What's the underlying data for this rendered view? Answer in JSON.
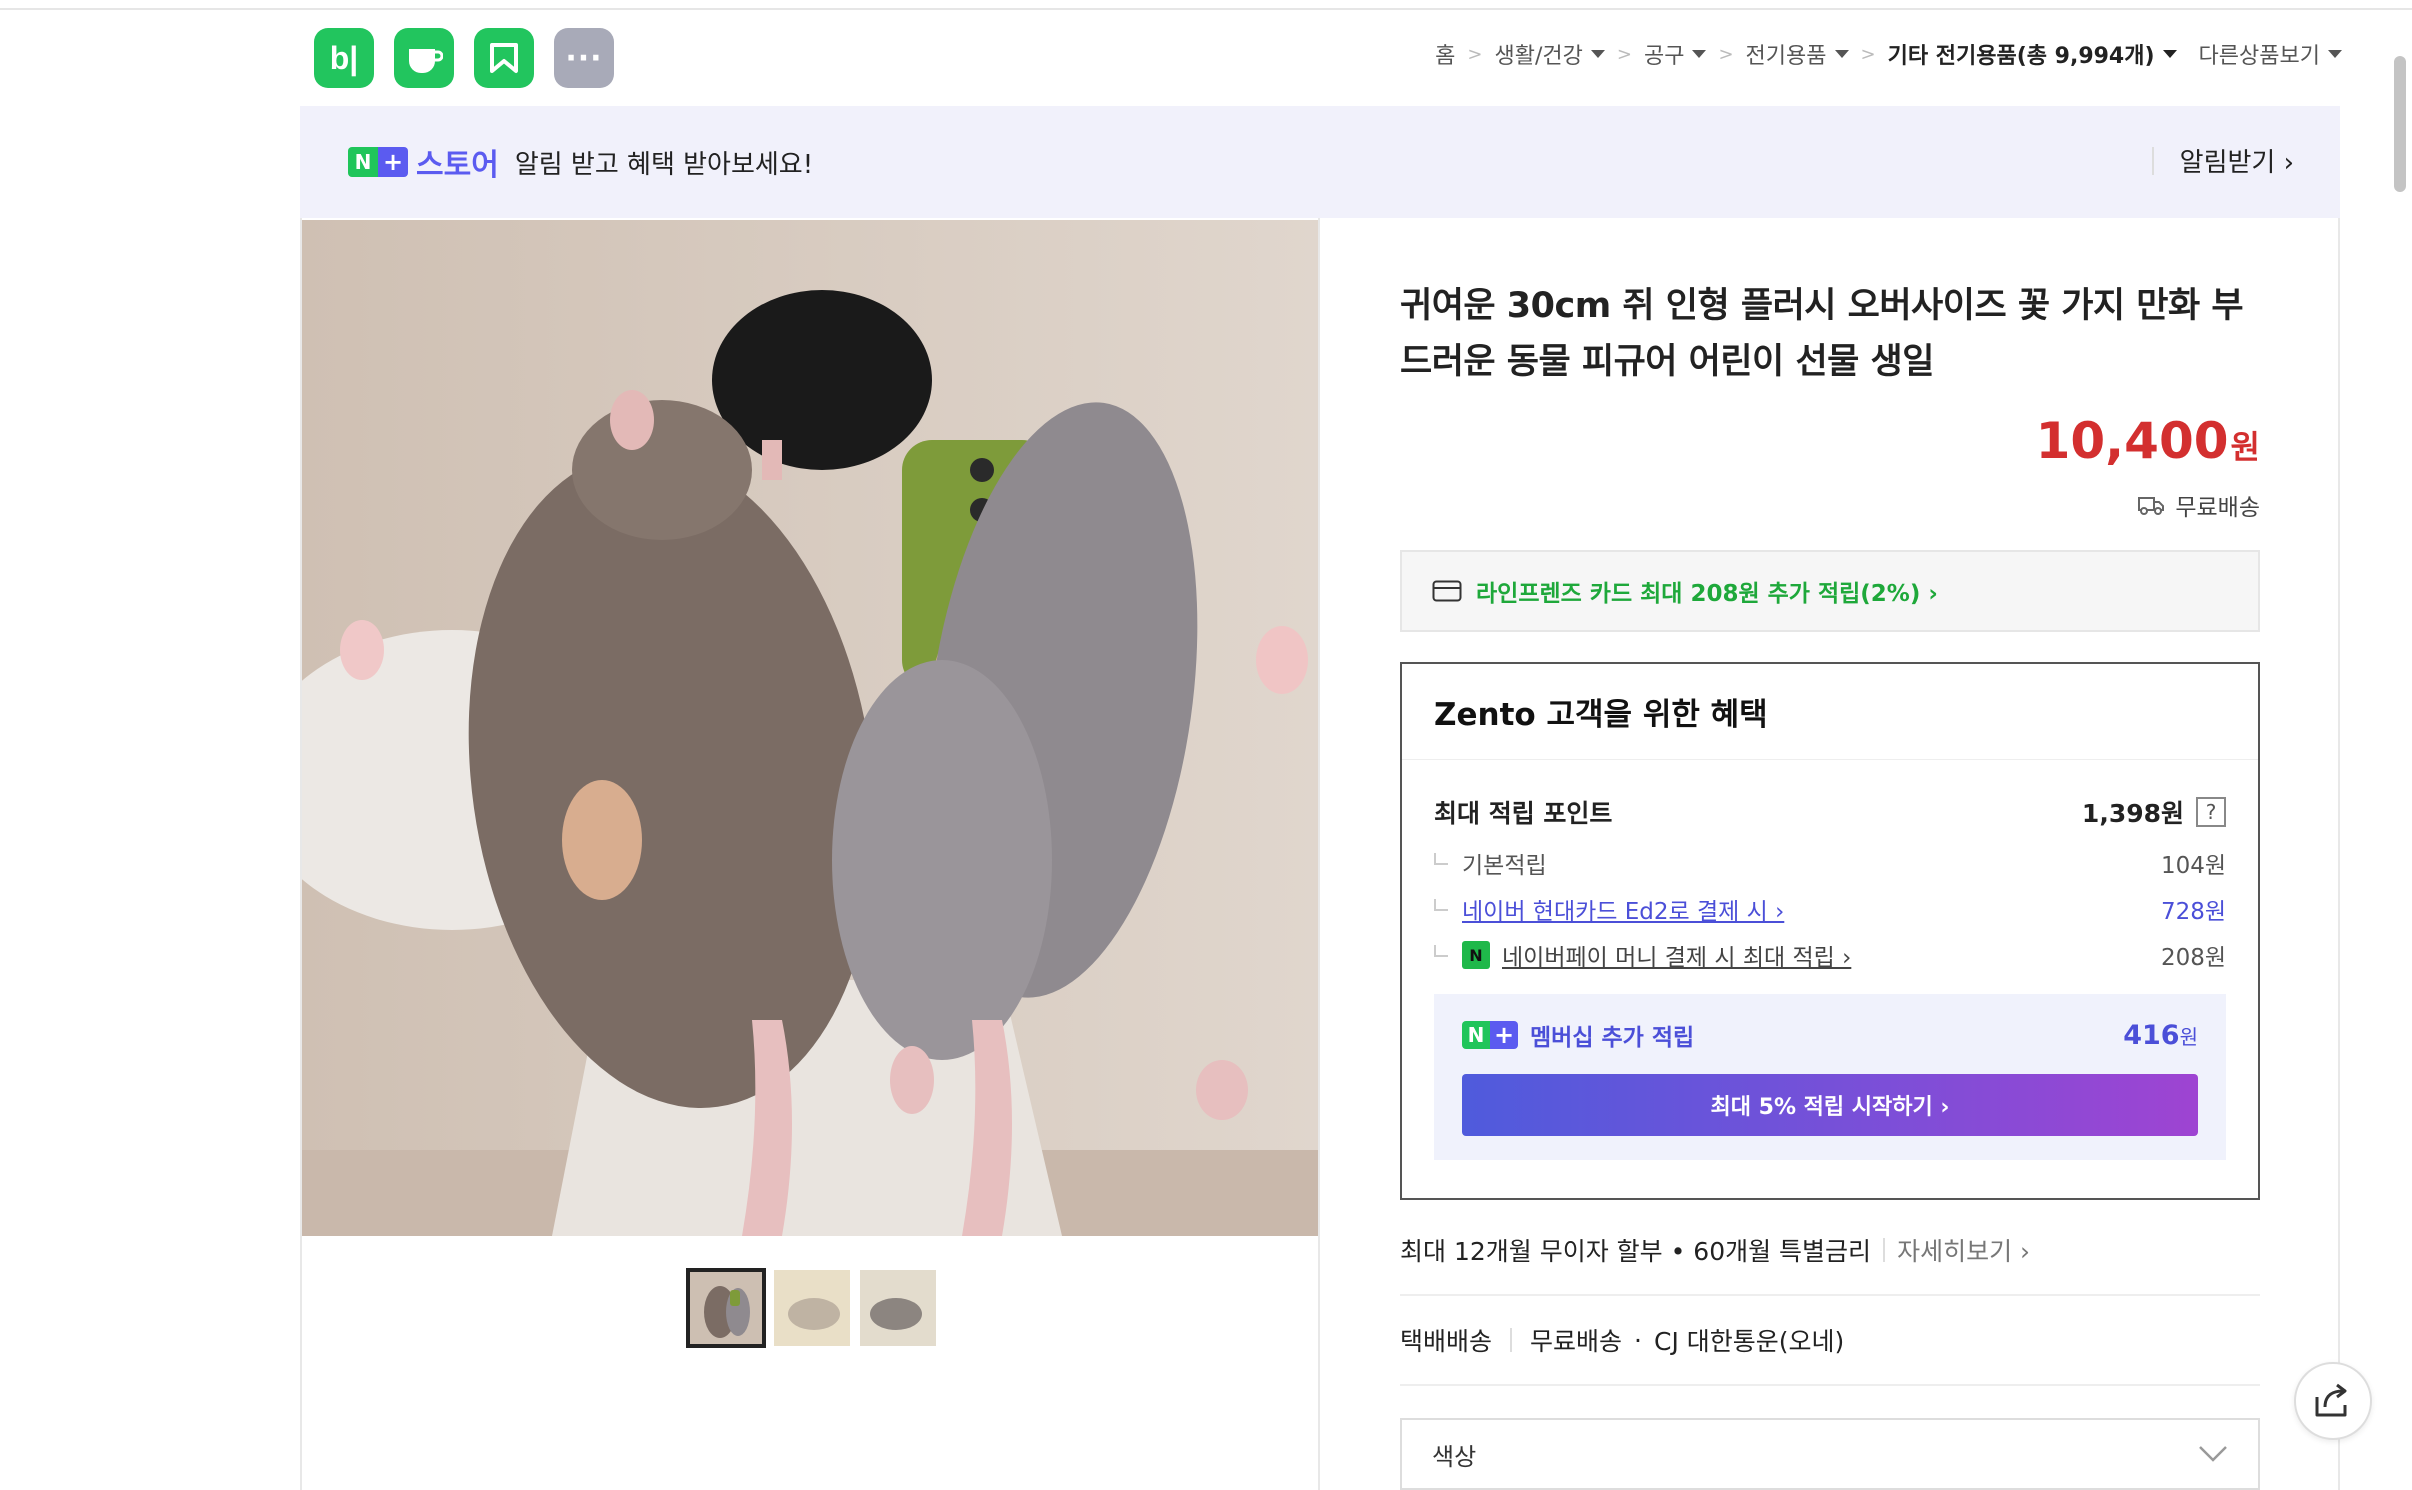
{
  "app_icons": [
    {
      "name": "blog",
      "label": "b|",
      "color": "#22c55e"
    },
    {
      "name": "cafe",
      "label": "",
      "color": "#22c55e"
    },
    {
      "name": "kurly",
      "label": "",
      "color": "#22c55e"
    },
    {
      "name": "more",
      "label": "···",
      "color": "#a8aab8"
    }
  ],
  "breadcrumb": {
    "home": "홈",
    "cat1": "생활/건강",
    "cat2": "공구",
    "cat3": "전기용품",
    "cat4": "기타 전기용품",
    "cat4_count": "(총 9,994개)",
    "other": "다른상품보기"
  },
  "banner": {
    "badge_n": "N",
    "badge_plus": "+",
    "store_word": "스토어",
    "message": "알림 받고 혜택 받아보세요!",
    "action": "알림받기 ›"
  },
  "product": {
    "title": "귀여운 30cm 쥐 인형 플러시 오버사이즈 꽃 가지 만화 부드러운 동물 피규어 어린이 선물 생일",
    "price": "10,400",
    "currency": "원",
    "shipping": "무료배송"
  },
  "card_promo": "라인프렌즈 카드 최대 208원 추가 적립(2%) ›",
  "benefit": {
    "heading": "Zento 고객을 위한 혜택",
    "max_points_label": "최대 적립 포인트",
    "max_points_value": "1,398원",
    "help": "?",
    "rows": [
      {
        "label": "기본적립",
        "value": "104원"
      },
      {
        "label": "네이버 현대카드 Ed2로 결제 시 ›",
        "value": "728원"
      },
      {
        "label": "네이버페이 머니 결제 시 최대 적립 ›",
        "value": "208원"
      }
    ],
    "npay_badge": "N",
    "membership_label": "멤버십 추가 적립",
    "membership_value": "416",
    "membership_unit": "원",
    "membership_button": "최대 5% 적립 시작하기 ›"
  },
  "installment": {
    "text": "최대 12개월 무이자 할부 • 60개월 특별금리",
    "more": "자세히보기 ›"
  },
  "delivery": {
    "type": "택배배송",
    "fee": "무료배송",
    "dot": "·",
    "carrier": "CJ 대한통운(오네)"
  },
  "option": {
    "label": "색상"
  },
  "colors": {
    "price_red": "#d32f2f",
    "naver_green": "#20c55a",
    "accent_purple": "#5b5bf0",
    "card_green": "#1ea83a"
  }
}
